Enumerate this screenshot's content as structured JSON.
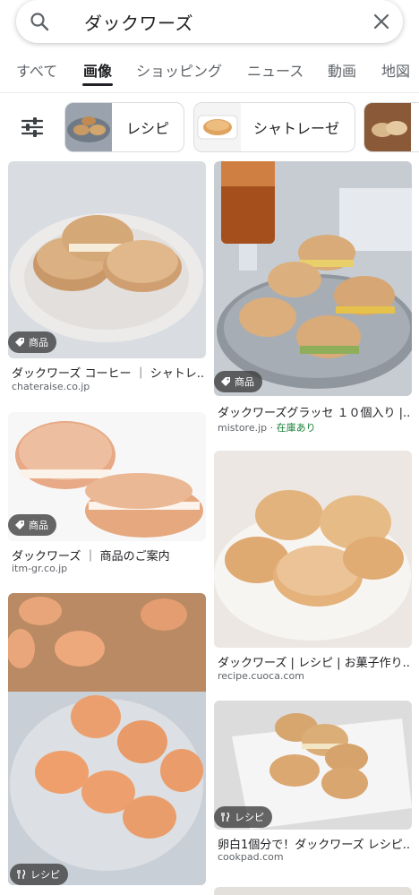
{
  "search": {
    "query": "ダックワーズ"
  },
  "tabs": [
    "すべて",
    "画像",
    "ショッピング",
    "ニュース",
    "動画",
    "地図"
  ],
  "chips": [
    "レシピ",
    "シャトレーゼ"
  ],
  "badges": {
    "product": "商品",
    "recipe": "レシピ"
  },
  "results": [
    {
      "title": "ダックワーズ コーヒー ｜ シャトレ...",
      "source": "chateraise.co.jp",
      "badge": "商品"
    },
    {
      "title": "ダックワーズグラッセ １０個入り |...",
      "source": "mistore.jp",
      "sep": " · ",
      "stock": "在庫あり",
      "badge": "商品"
    },
    {
      "title": "ダックワーズ ｜ 商品のご案内",
      "source": "itm-gr.co.jp",
      "badge": "商品"
    },
    {
      "title": "ダックワーズ | レシピ | お菓子作り...",
      "source": "recipe.cuoca.com"
    },
    {
      "title": "",
      "source": "",
      "badge": "レシピ"
    },
    {
      "title": "卵白1個分で！ダックワーズ レシピ...",
      "source": "cookpad.com",
      "badge": "レシピ"
    }
  ],
  "colors": {
    "accent": "#202124",
    "stock": "#188038",
    "chipBorder": "#dadce0"
  }
}
